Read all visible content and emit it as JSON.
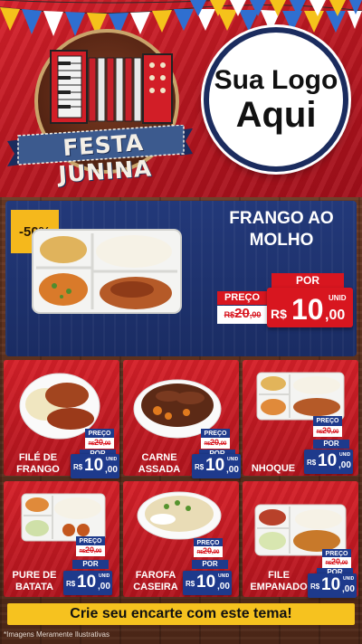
{
  "header": {
    "banner_title": "FESTA JUNINA",
    "logo_line1": "Sua Logo",
    "logo_line2": "Aqui"
  },
  "featured": {
    "discount": "-50%",
    "title_line1": "FRANGO AO",
    "title_line2": "MOLHO",
    "por_label": "POR",
    "preco_label": "PREÇO",
    "old_currency": "R$",
    "old_int": "20",
    "old_dec": ",00",
    "currency": "R$",
    "price_int": "10",
    "price_dec": ",00",
    "unit": "UNID"
  },
  "products": [
    {
      "name_line1": "FILÉ DE",
      "name_line2": "FRANGO",
      "preco_label": "PREÇO",
      "old_currency": "R$",
      "old_int": "20",
      "old_dec": ",00",
      "por_label": "POR",
      "currency": "R$",
      "price_int": "10",
      "price_dec": ",00",
      "unit": "UNID"
    },
    {
      "name_line1": "CARNE",
      "name_line2": "ASSADA",
      "preco_label": "PREÇO",
      "old_currency": "R$",
      "old_int": "20",
      "old_dec": ",00",
      "por_label": "POR",
      "currency": "R$",
      "price_int": "10",
      "price_dec": ",00",
      "unit": "UNID"
    },
    {
      "name_line1": "NHOQUE",
      "name_line2": "",
      "preco_label": "PREÇO",
      "old_currency": "R$",
      "old_int": "20",
      "old_dec": ",00",
      "por_label": "POR",
      "currency": "R$",
      "price_int": "10",
      "price_dec": ",00",
      "unit": "UNID"
    },
    {
      "name_line1": "PURE DE",
      "name_line2": "BATATA",
      "preco_label": "PREÇO",
      "old_currency": "R$",
      "old_int": "20",
      "old_dec": ",00",
      "por_label": "POR",
      "currency": "R$",
      "price_int": "10",
      "price_dec": ",00",
      "unit": "UNID"
    },
    {
      "name_line1": "FAROFA",
      "name_line2": "CASEIRA",
      "preco_label": "PREÇO",
      "old_currency": "R$",
      "old_int": "20",
      "old_dec": ",00",
      "por_label": "POR",
      "currency": "R$",
      "price_int": "10",
      "price_dec": ",00",
      "unit": "UNID"
    },
    {
      "name_line1": "FILE",
      "name_line2": "EMPANADO",
      "preco_label": "PREÇO",
      "old_currency": "R$",
      "old_int": "20",
      "old_dec": ",00",
      "por_label": "POR",
      "currency": "R$",
      "price_int": "10",
      "price_dec": ",00",
      "unit": "UNID"
    }
  ],
  "footer": {
    "cta": "Crie seu encarte com este tema!",
    "disclaimer": "*Imagens Meramente Ilustrativas"
  },
  "colors": {
    "red": "#d8161f",
    "navy": "#1e3a8c",
    "yellow": "#f6c21f"
  }
}
